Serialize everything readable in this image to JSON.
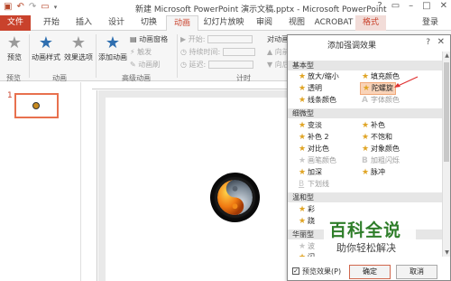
{
  "window": {
    "title": "新建 Microsoft PowerPoint 演示文稿.pptx - Microsoft PowerPoint",
    "qat_icons": [
      "save-icon",
      "undo-icon",
      "redo-icon",
      "slideshow-icon"
    ],
    "controls": [
      "?",
      "▭",
      "–",
      "□",
      "✕"
    ]
  },
  "tabs": {
    "file": "文件",
    "items": [
      "开始",
      "插入",
      "设计",
      "切换",
      "动画",
      "幻灯片放映",
      "审阅",
      "视图",
      "ACROBAT",
      "格式"
    ],
    "active": "动画",
    "login": "登录"
  },
  "ribbon": {
    "preview": "预览",
    "preview_group": "预览",
    "anim_style": "动画样式",
    "effect_options": "效果选项",
    "anim_group": "动画",
    "add_anim": "添加动画",
    "anim_pane": "动画窗格",
    "trigger": "触发",
    "anim_painter": "动画刷",
    "adv_group": "高级动画",
    "start": "开始:",
    "duration": "持续时间:",
    "delay": "延迟:",
    "timing_group": "计时",
    "reorder": "对动画重新排",
    "move_earlier": "▲ 向前移",
    "move_later": "▼ 向后移"
  },
  "slides": {
    "number": "1"
  },
  "dialog": {
    "title": "添加强调效果",
    "help": "?",
    "close": "✕",
    "categories": [
      "基本型",
      "细微型",
      "温和型",
      "华丽型"
    ],
    "basic": [
      {
        "label": "放大/缩小",
        "disabled": false
      },
      {
        "label": "填充颜色",
        "disabled": false
      },
      {
        "label": "透明",
        "disabled": false
      },
      {
        "label": "陀螺旋",
        "disabled": false,
        "selected": true
      },
      {
        "label": "线条颜色",
        "disabled": false
      },
      {
        "label": "字体颜色",
        "disabled": true
      }
    ],
    "subtle": [
      {
        "label": "变淡",
        "disabled": false
      },
      {
        "label": "补色",
        "disabled": false
      },
      {
        "label": "补色 2",
        "disabled": false
      },
      {
        "label": "不饱和",
        "disabled": false
      },
      {
        "label": "对比色",
        "disabled": false
      },
      {
        "label": "对象颜色",
        "disabled": false
      },
      {
        "label": "画笔颜色",
        "disabled": true
      },
      {
        "label": "加粗闪烁",
        "disabled": true
      },
      {
        "label": "加深",
        "disabled": false
      },
      {
        "label": "脉冲",
        "disabled": false
      },
      {
        "label": "下划线",
        "disabled": true
      }
    ],
    "moderate": [
      {
        "label": "彩",
        "disabled": false
      },
      {
        "label": "跷",
        "disabled": false
      }
    ],
    "exciting": [
      {
        "label": "波",
        "disabled": true
      },
      {
        "label": "闪",
        "disabled": false
      }
    ],
    "preview_effect": "预览效果(P)",
    "ok": "确定",
    "cancel": "取消"
  },
  "watermark": {
    "line1": "百科全说",
    "line2": "助你轻松解决"
  },
  "colors": {
    "accent": "#c9422c",
    "star": "#e0a424",
    "selected_bg": "#f9d3b8",
    "watermark_green": "#2f7e2a"
  }
}
